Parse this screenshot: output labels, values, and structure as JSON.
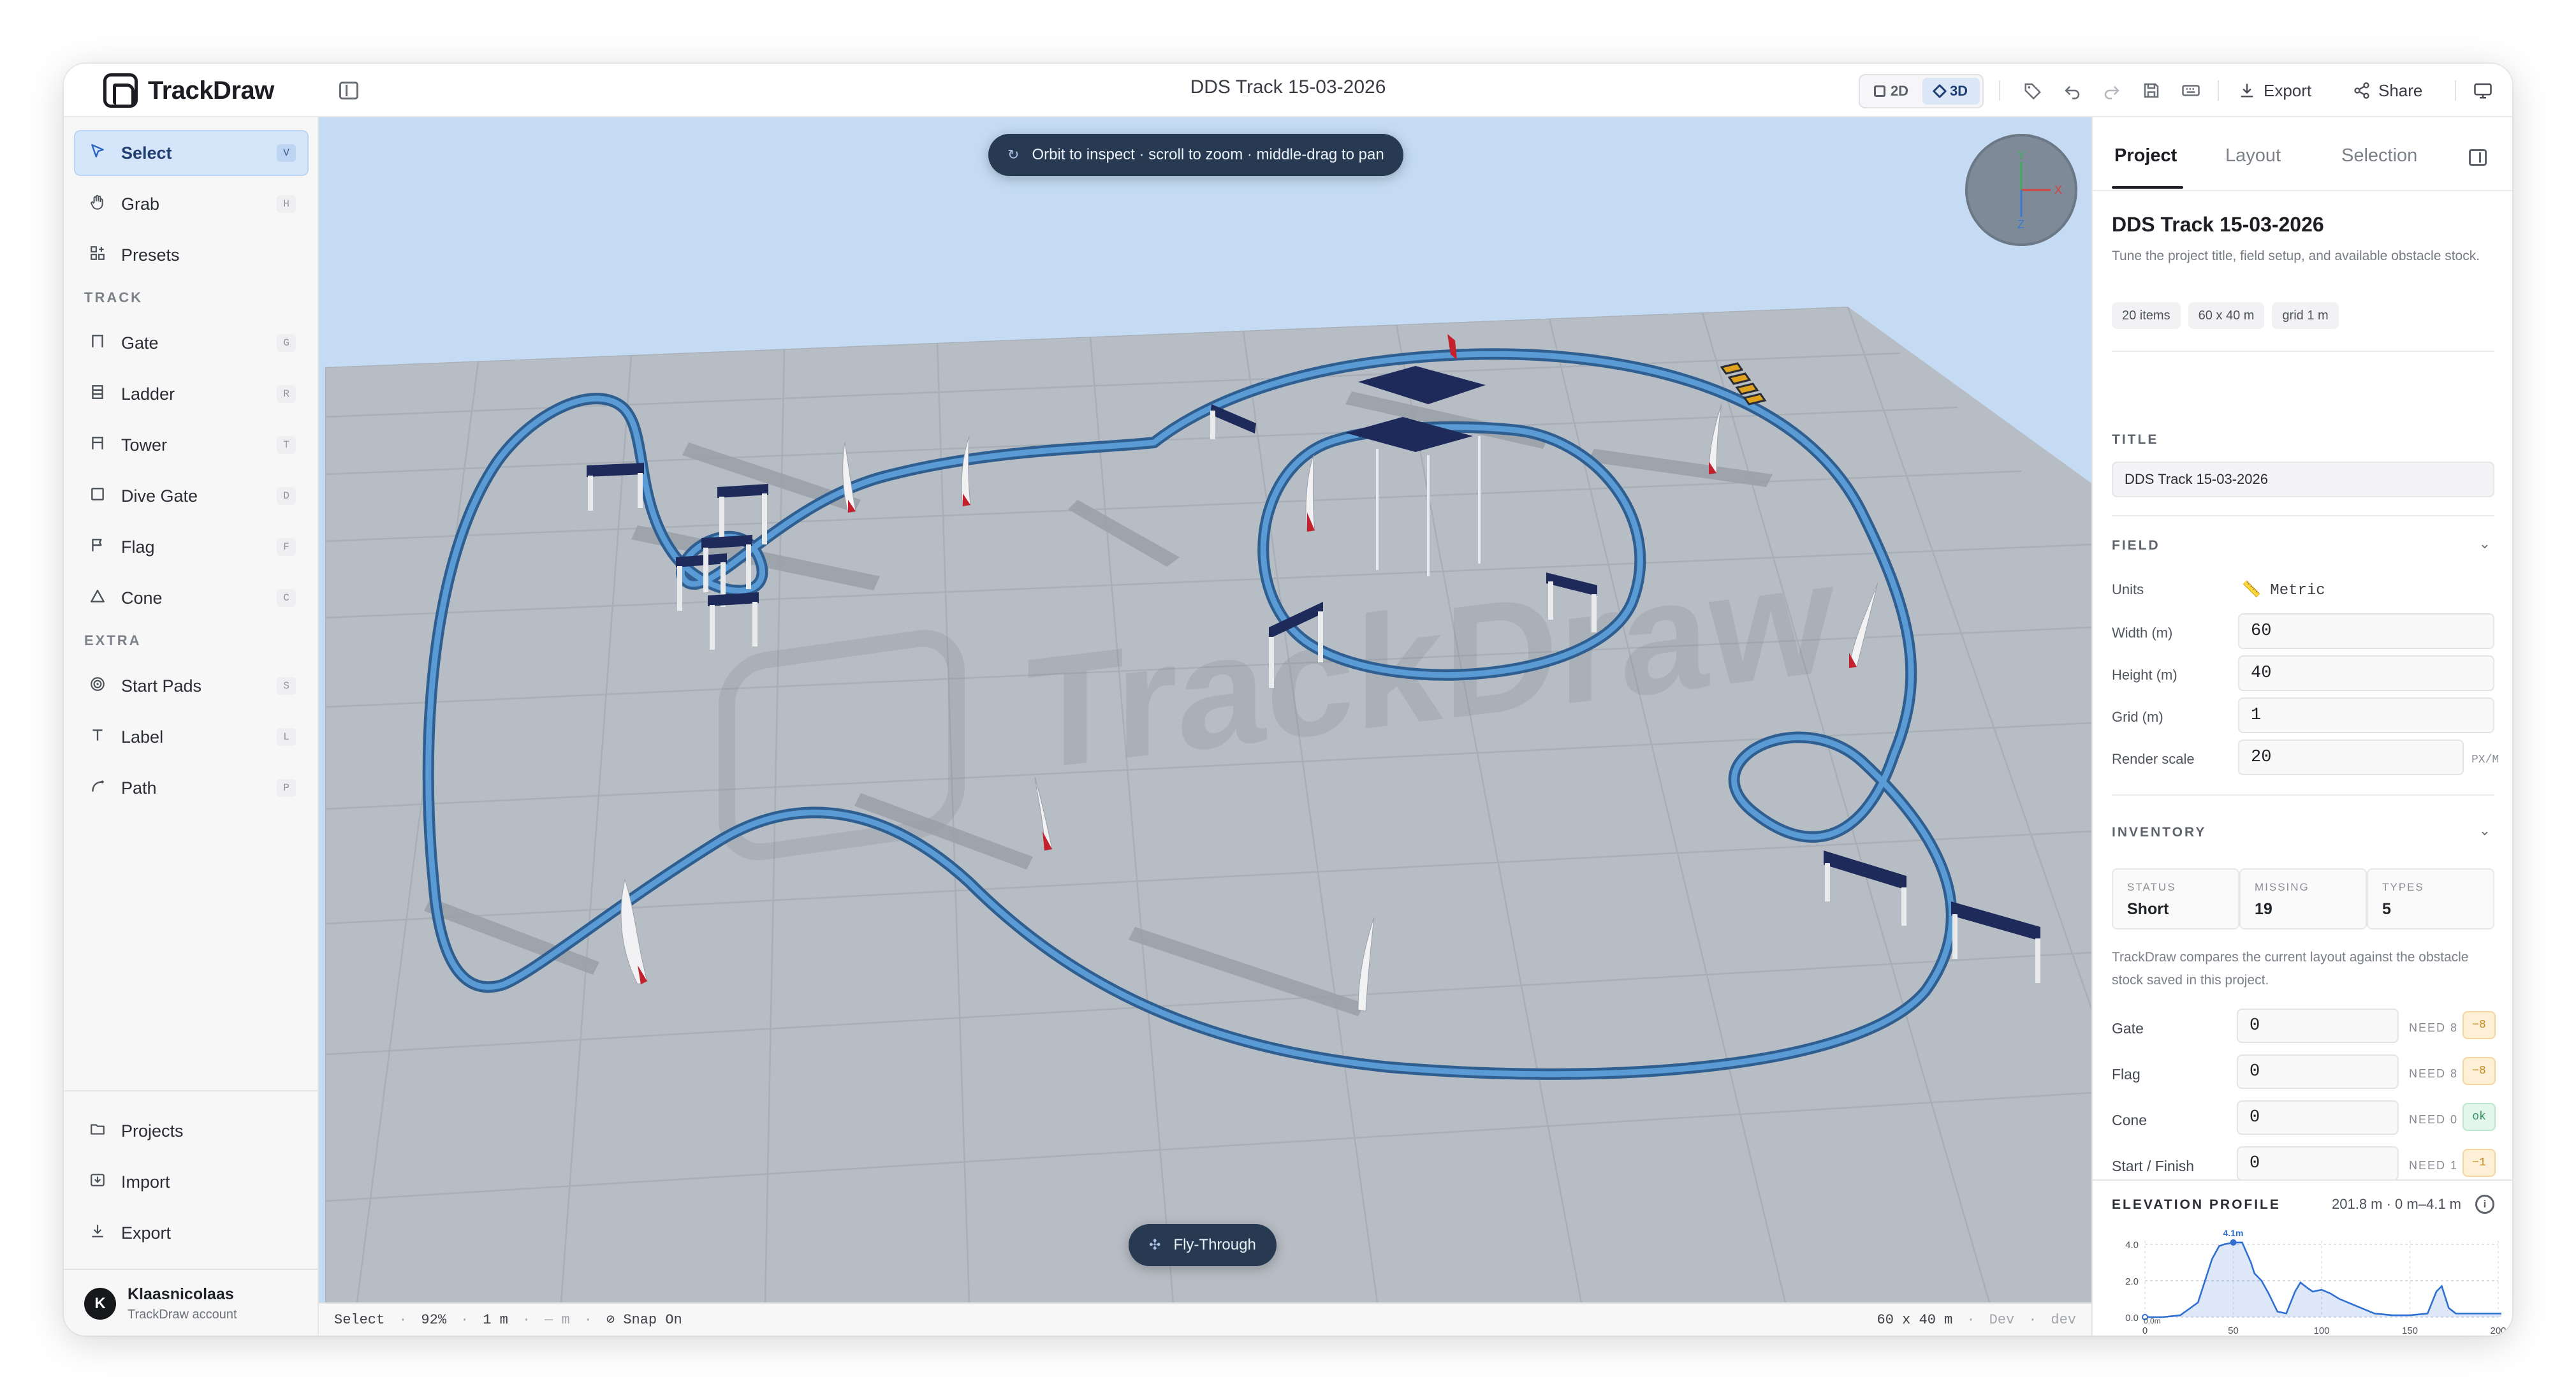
{
  "app": {
    "name": "TrackDraw",
    "document_title": "DDS Track 15-03-2026"
  },
  "topbar": {
    "view_2d": "2D",
    "view_3d": "3D",
    "active_view": "3D",
    "export_label": "Export",
    "share_label": "Share",
    "icons": [
      "tag-icon",
      "undo-icon",
      "redo-icon",
      "save-icon",
      "keyboard-icon",
      "download-icon",
      "share-icon",
      "monitor-icon"
    ]
  },
  "sidebar": {
    "tools": [
      {
        "label": "Select",
        "key": "V",
        "icon": "cursor-icon",
        "active": true
      },
      {
        "label": "Grab",
        "key": "H",
        "icon": "hand-icon"
      },
      {
        "label": "Presets",
        "key": "",
        "icon": "grid-plus-icon"
      }
    ],
    "track_section": "TRACK",
    "track_tools": [
      {
        "label": "Gate",
        "key": "G",
        "icon": "gate-icon"
      },
      {
        "label": "Ladder",
        "key": "R",
        "icon": "ladder-icon"
      },
      {
        "label": "Tower",
        "key": "T",
        "icon": "tower-icon"
      },
      {
        "label": "Dive Gate",
        "key": "D",
        "icon": "dive-gate-icon"
      },
      {
        "label": "Flag",
        "key": "F",
        "icon": "flag-icon"
      },
      {
        "label": "Cone",
        "key": "C",
        "icon": "cone-icon"
      }
    ],
    "extra_section": "EXTRA",
    "extra_tools": [
      {
        "label": "Start Pads",
        "key": "S",
        "icon": "target-icon"
      },
      {
        "label": "Label",
        "key": "L",
        "icon": "text-icon"
      },
      {
        "label": "Path",
        "key": "P",
        "icon": "path-icon"
      }
    ],
    "bottom": [
      {
        "label": "Projects",
        "icon": "folder-icon"
      },
      {
        "label": "Import",
        "icon": "import-icon"
      },
      {
        "label": "Export",
        "icon": "export-icon"
      }
    ],
    "user": {
      "initial": "K",
      "name": "Klaasnicolaas",
      "subtitle": "TrackDraw account"
    }
  },
  "viewport": {
    "hint": "Orbit to inspect · scroll to zoom · middle-drag to pan",
    "fly_through": "Fly-Through",
    "watermark": "TrackDraw",
    "axes": {
      "x": "X",
      "y": "Y",
      "z": "Z"
    },
    "colors": {
      "sky": "#c4dbf3",
      "ground": "#b6bcc3",
      "path": "#4a8ac4",
      "banner": "#1d2a5a",
      "flag_red": "#c4202e"
    }
  },
  "statusbar": {
    "tool": "Select",
    "zoom": "92%",
    "grid": "1 m",
    "cursor": "— m",
    "snap": "Snap On",
    "field": "60 x 40 m",
    "env": "Dev",
    "env2": "dev",
    "sep": "·"
  },
  "panel": {
    "tabs": [
      "Project",
      "Layout",
      "Selection"
    ],
    "active_tab": "Project",
    "project_title": "DDS Track 15-03-2026",
    "project_desc": "Tune the project title, field setup, and available obstacle stock.",
    "chips": [
      "20 items",
      "60 x 40 m",
      "grid 1 m"
    ],
    "title_section": "TITLE",
    "title_value": "DDS Track 15-03-2026",
    "field_section": "FIELD",
    "units_label": "Units",
    "units_value": "Metric",
    "width_label": "Width (m)",
    "width_value": "60",
    "height_label": "Height (m)",
    "height_value": "40",
    "grid_label": "Grid (m)",
    "grid_value": "1",
    "scale_label": "Render scale",
    "scale_value": "20",
    "scale_unit": "PX/M",
    "inventory_section": "INVENTORY",
    "status_k": "STATUS",
    "status_v": "Short",
    "missing_k": "MISSING",
    "missing_v": "19",
    "types_k": "TYPES",
    "types_v": "5",
    "inventory_note": "TrackDraw compares the current layout against the obstacle stock saved in this project.",
    "inventory_rows": [
      {
        "label": "Gate",
        "value": "0",
        "need": "NEED 8",
        "badge": "−8",
        "state": "warn"
      },
      {
        "label": "Flag",
        "value": "0",
        "need": "NEED 8",
        "badge": "−8",
        "state": "warn"
      },
      {
        "label": "Cone",
        "value": "0",
        "need": "NEED 0",
        "badge": "ok",
        "state": "ok"
      },
      {
        "label": "Start / Finish",
        "value": "0",
        "need": "NEED 1",
        "badge": "−1",
        "state": "warn"
      }
    ]
  },
  "elevation": {
    "title": "ELEVATION PROFILE",
    "meta": "201.8 m · 0 m–4.1 m",
    "peak_label": "4.1m",
    "start_label": "0.0m"
  },
  "chart_data": {
    "type": "area",
    "title": "ELEVATION PROFILE",
    "xlabel": "",
    "ylabel": "",
    "x": [
      0,
      10,
      20,
      30,
      38,
      42,
      45,
      50,
      55,
      60,
      62,
      66,
      70,
      75,
      80,
      85,
      88,
      92,
      95,
      100,
      105,
      110,
      120,
      130,
      140,
      150,
      160,
      165,
      168,
      172,
      176,
      180,
      190,
      201.8
    ],
    "y": [
      0,
      0,
      0.1,
      0.8,
      3.2,
      3.9,
      4.0,
      4.1,
      4.1,
      3.0,
      2.4,
      2.0,
      1.3,
      0.3,
      0.2,
      1.4,
      1.9,
      1.6,
      1.4,
      1.5,
      1.3,
      1.0,
      0.6,
      0.2,
      0.1,
      0.1,
      0.2,
      1.4,
      1.7,
      0.5,
      0.2,
      0.2,
      0.2,
      0.2
    ],
    "xlim": [
      0,
      200
    ],
    "ylim": [
      0,
      4.2
    ],
    "xticks": [
      0,
      50,
      100,
      150,
      200
    ],
    "yticks": [
      0.0,
      2.0,
      4.0
    ],
    "ytick_labels": [
      "0.0",
      "2.0",
      "4.0"
    ],
    "grid": true,
    "color": "#2f6fd1"
  }
}
